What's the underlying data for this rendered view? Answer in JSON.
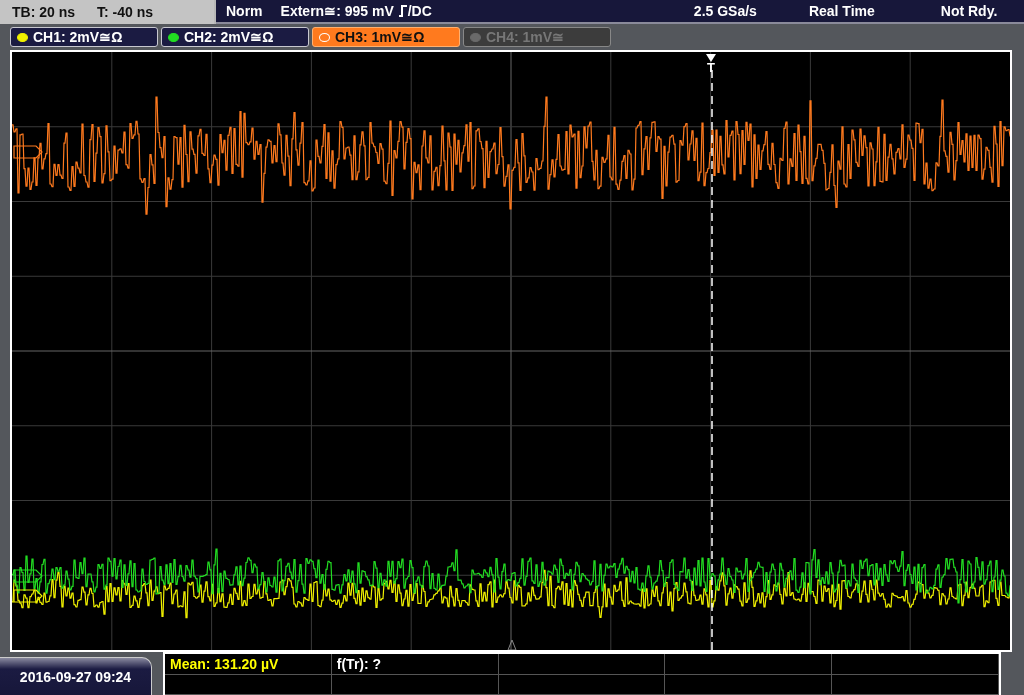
{
  "status_bar": {
    "timebase": "TB: 20 ns",
    "trigger_offset": "T: -40 ns",
    "trigger_mode": "Norm",
    "trigger_source": "Extern≅: 995 mV",
    "trigger_coupling": "/DC",
    "sample_rate": "2.5 GSa/s",
    "acquisition_mode": "Real Time",
    "state": "Not Rdy."
  },
  "channels": [
    {
      "label": "CH1: 2mV≅Ω",
      "color": "#f0f000",
      "selected": false,
      "enabled": true
    },
    {
      "label": "CH2: 2mV≅Ω",
      "color": "#22dd22",
      "selected": false,
      "enabled": true
    },
    {
      "label": "CH3: 1mV≅Ω",
      "color": "#ff7a1e",
      "selected": true,
      "enabled": true
    },
    {
      "label": "CH4: 1mV≅",
      "color": "#6a6a6a",
      "selected": false,
      "enabled": false
    }
  ],
  "trigger_marker": "T",
  "measurements": [
    {
      "label": "Mean: 131.20 µV",
      "color": "#ffff00"
    },
    {
      "label": "f(Tr): ?",
      "color": "#ffffff"
    }
  ],
  "date_time": "2016-09-27 09:24"
}
